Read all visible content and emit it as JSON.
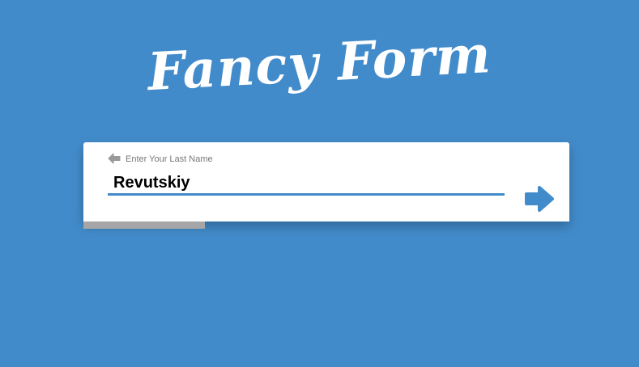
{
  "header": {
    "title": "Fancy Form"
  },
  "form": {
    "field_label": "Enter Your Last Name",
    "field_value": "Revutskiy",
    "back_icon": "arrow-left-icon",
    "next_icon": "arrow-right-icon"
  },
  "progress": {
    "fraction": 0.25
  },
  "colors": {
    "background": "#428bca",
    "card": "#ffffff",
    "accent": "#428bca",
    "progress": "#a6a6a6",
    "label": "#777777",
    "back_icon": "#999999"
  }
}
